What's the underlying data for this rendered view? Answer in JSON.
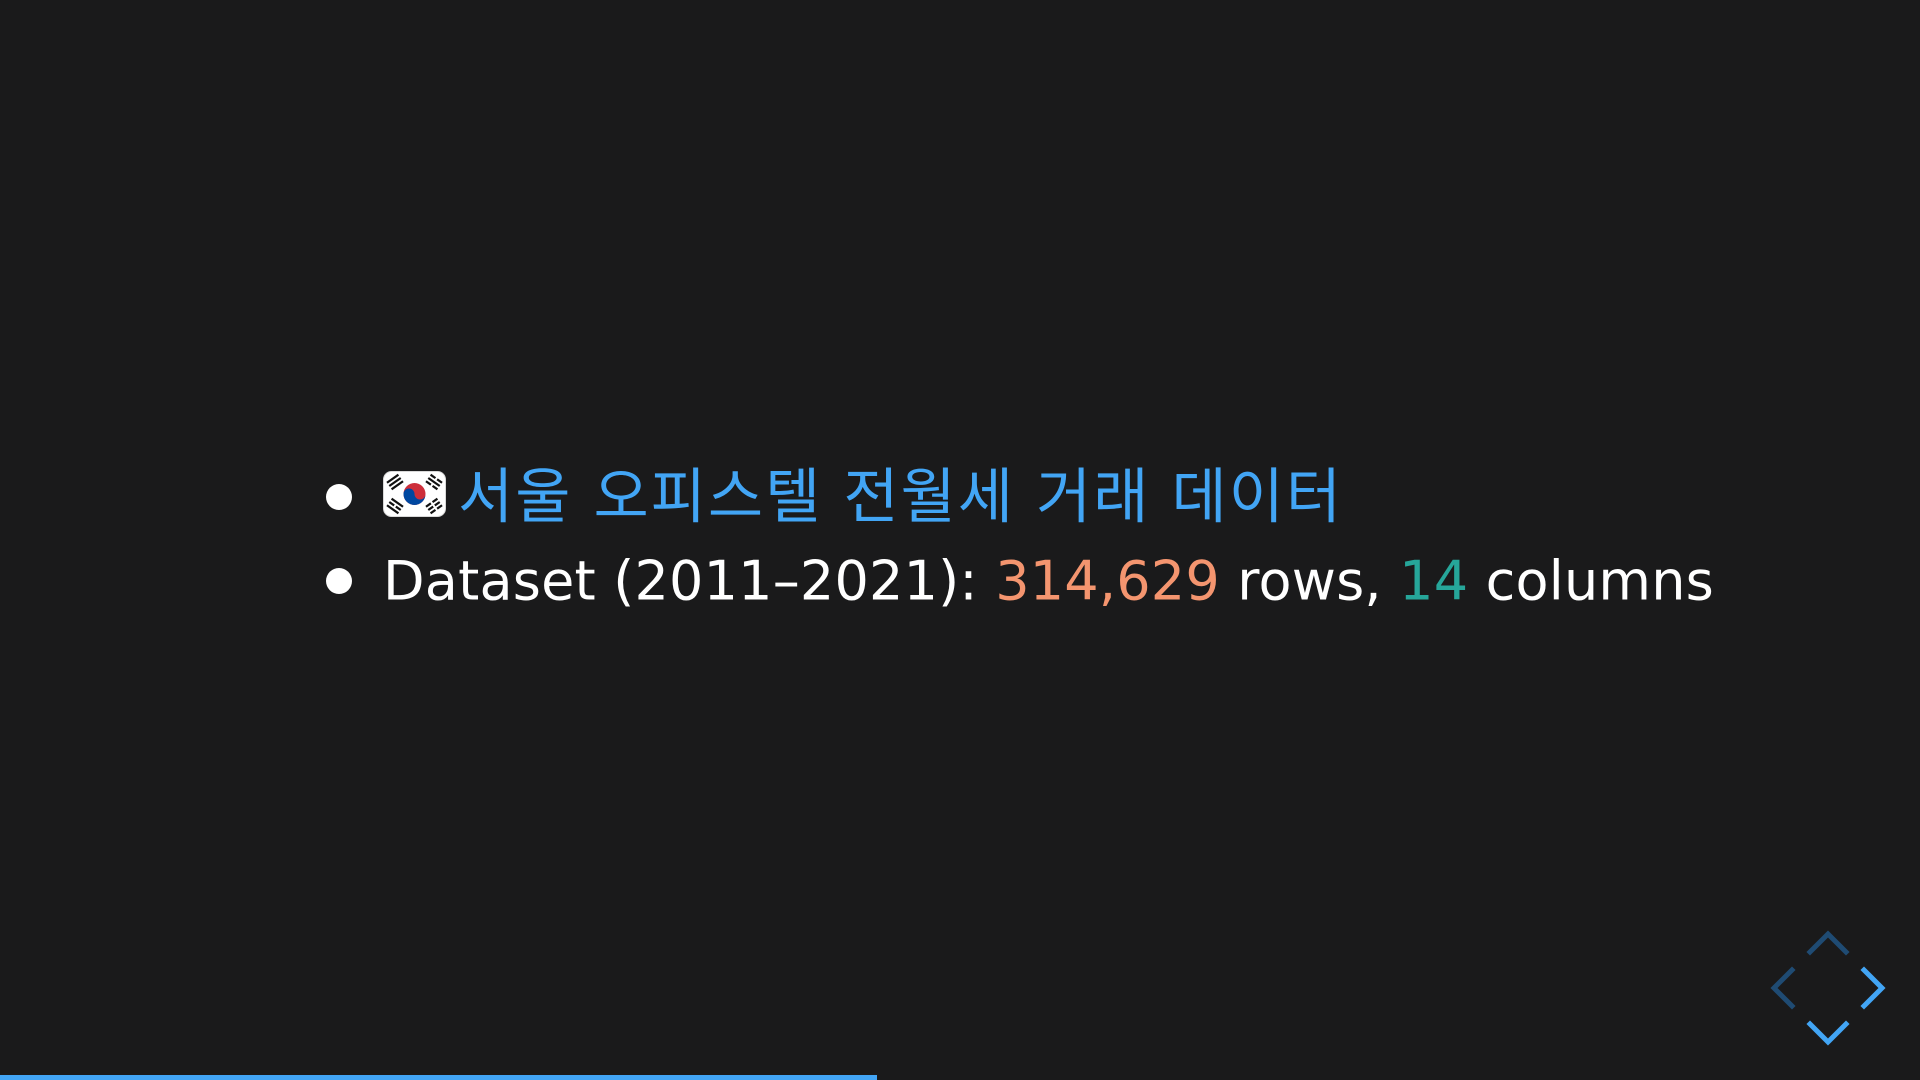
{
  "slide": {
    "bullets": [
      {
        "flag_icon": "south-korea-flag-icon",
        "title": "서울 오피스텔 전월세 거래 데이터"
      },
      {
        "prefix": "Dataset (2011–2021): ",
        "rows_value": "314,629",
        "rows_suffix": " rows, ",
        "columns_value": "14",
        "columns_suffix": " columns"
      }
    ]
  },
  "controls": {
    "up": "chevron-up-icon",
    "down": "chevron-down-icon",
    "left": "chevron-left-icon",
    "right": "chevron-right-icon"
  },
  "progress": {
    "fraction": 0.457
  },
  "colors": {
    "background": "#1a1a1b",
    "text": "#ffffff",
    "accent_blue": "#42a5f5",
    "accent_orange": "#f4956f",
    "accent_teal": "#26a69a",
    "control_dim": "#1f4b73",
    "control_bright": "#42a5f5"
  }
}
